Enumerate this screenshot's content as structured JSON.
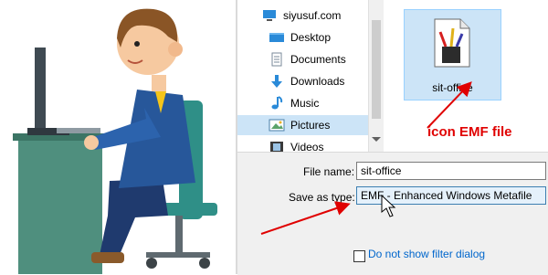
{
  "nav": {
    "items": [
      {
        "label": "siyusuf.com",
        "icon": "computer-icon"
      },
      {
        "label": "Desktop",
        "icon": "desktop-folder-icon"
      },
      {
        "label": "Documents",
        "icon": "documents-icon"
      },
      {
        "label": "Downloads",
        "icon": "download-arrow-icon"
      },
      {
        "label": "Music",
        "icon": "music-note-icon"
      },
      {
        "label": "Pictures",
        "icon": "pictures-icon",
        "selected": true
      },
      {
        "label": "Videos",
        "icon": "videos-icon"
      }
    ]
  },
  "file_tile": {
    "name": "sit-office",
    "icon": "emf-file-icon"
  },
  "form": {
    "file_name_label": "File name:",
    "file_name_value": "sit-office",
    "save_type_label": "Save as type:",
    "save_type_value": "EMF - Enhanced Windows Metafile"
  },
  "filter": {
    "label": "Do not show filter dialog"
  },
  "annotation": {
    "text": "icon EMF file",
    "color": "#e00000"
  },
  "colors": {
    "selection": "#cce4f7",
    "accent_red": "#e00000",
    "link": "#0066cc"
  }
}
